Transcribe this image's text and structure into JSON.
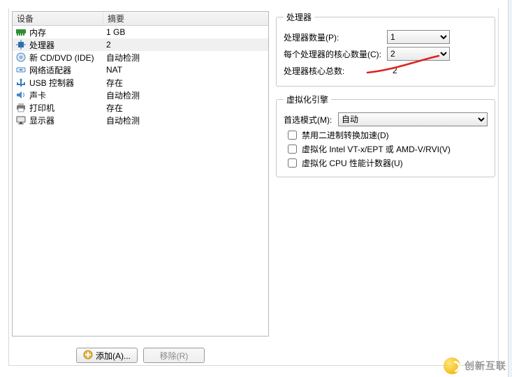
{
  "headers": {
    "device": "设备",
    "summary": "摘要"
  },
  "devices": [
    {
      "icon": "memory-icon",
      "name": "内存",
      "summary": "1 GB",
      "selected": false
    },
    {
      "icon": "cpu-icon",
      "name": "处理器",
      "summary": "2",
      "selected": true
    },
    {
      "icon": "cd-icon",
      "name": "新 CD/DVD (IDE)",
      "summary": "自动检测",
      "selected": false
    },
    {
      "icon": "network-icon",
      "name": "网络适配器",
      "summary": "NAT",
      "selected": false
    },
    {
      "icon": "usb-icon",
      "name": "USB 控制器",
      "summary": "存在",
      "selected": false
    },
    {
      "icon": "sound-icon",
      "name": "声卡",
      "summary": "自动检测",
      "selected": false
    },
    {
      "icon": "printer-icon",
      "name": "打印机",
      "summary": "存在",
      "selected": false
    },
    {
      "icon": "display-icon",
      "name": "显示器",
      "summary": "自动检测",
      "selected": false
    }
  ],
  "buttons": {
    "add": "添加(A)...",
    "remove": "移除(R)"
  },
  "processor_group": {
    "title": "处理器",
    "count_label": "处理器数量(P):",
    "count_value": "1",
    "cores_label": "每个处理器的核心数量(C):",
    "cores_value": "2",
    "total_label": "处理器核心总数:",
    "total_value": "2"
  },
  "virt_group": {
    "title": "虚拟化引擎",
    "mode_label": "首选模式(M):",
    "mode_value": "自动",
    "chk1": "禁用二进制转换加速(D)",
    "chk2": "虚拟化 Intel VT-x/EPT 或 AMD-V/RVI(V)",
    "chk3": "虚拟化 CPU 性能计数器(U)"
  },
  "watermark": "创新互联",
  "icon_colors": {
    "memory-icon": "#2f8f2f",
    "cpu-icon": "#2f6fb0",
    "cd-icon": "#4a88c8",
    "network-icon": "#4a88c8",
    "usb-icon": "#3a7ac0",
    "sound-icon": "#4a88c8",
    "printer-icon": "#777777",
    "display-icon": "#555555"
  }
}
